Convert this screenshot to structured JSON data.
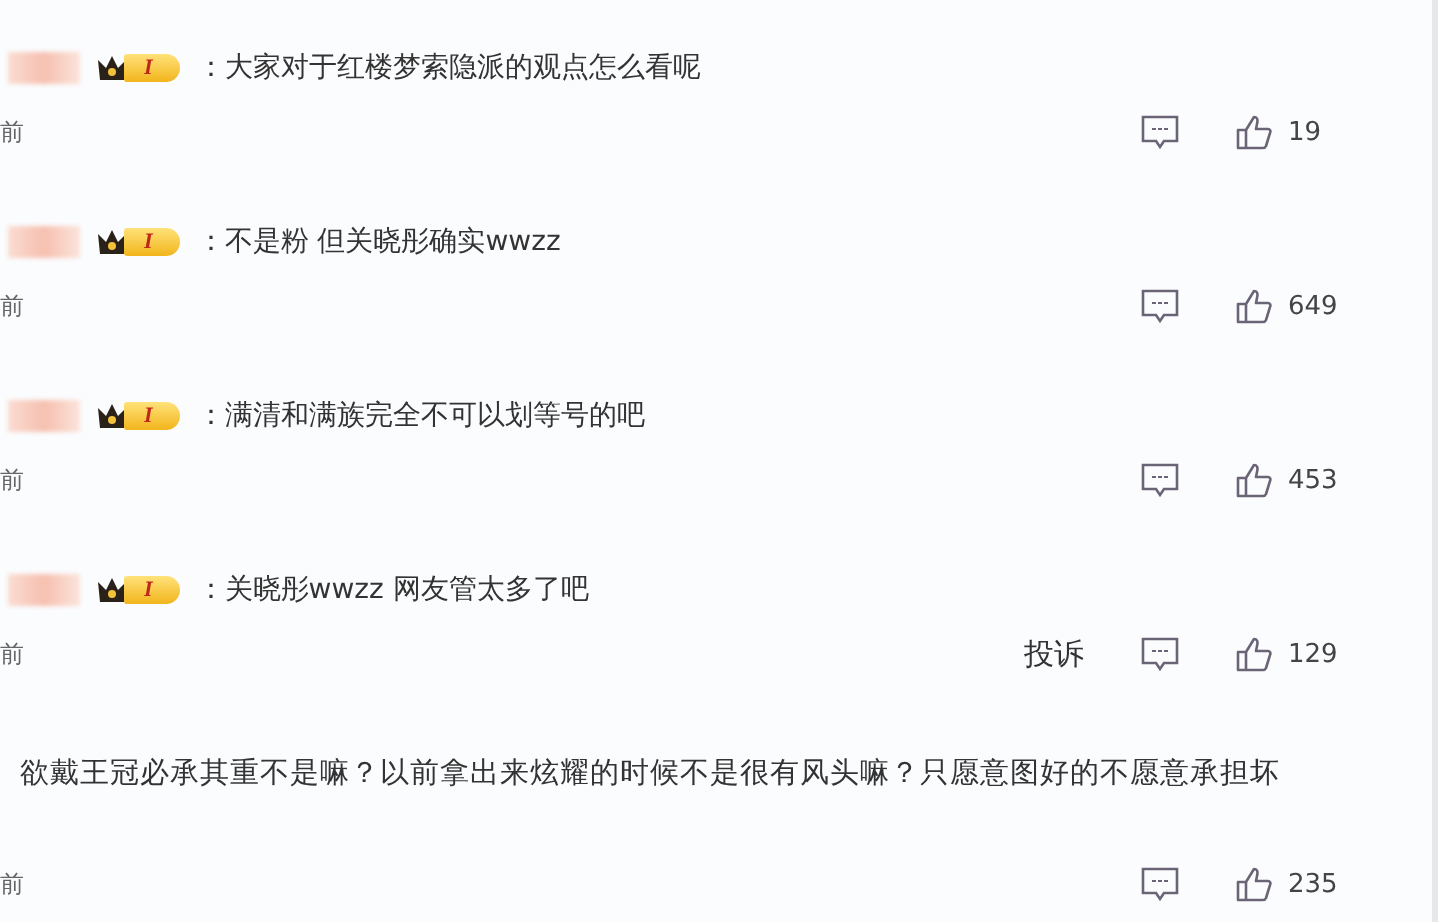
{
  "comments": [
    {
      "kind": "user",
      "badge": "I",
      "text": "：大家对于红楼梦索隐派的观点怎么看呢",
      "time": "前",
      "likes": "19"
    },
    {
      "kind": "user",
      "badge": "I",
      "text": "：不是粉 但关晓彤确实wwzz",
      "time": "前",
      "likes": "649"
    },
    {
      "kind": "user",
      "badge": "I",
      "text": "：满清和满族完全不可以划等号的吧",
      "time": "前",
      "likes": "453"
    },
    {
      "kind": "user",
      "badge": "I",
      "text": "：关晓彤wwzz 网友管太多了吧",
      "time": "前",
      "likes": "129",
      "report": "投诉"
    },
    {
      "kind": "plain",
      "text": "欲戴王冠必承其重不是嘛？以前拿出来炫耀的时候不是很有风头嘛？只愿意图好的不愿意承担坏",
      "time": "前",
      "likes": "235"
    }
  ]
}
